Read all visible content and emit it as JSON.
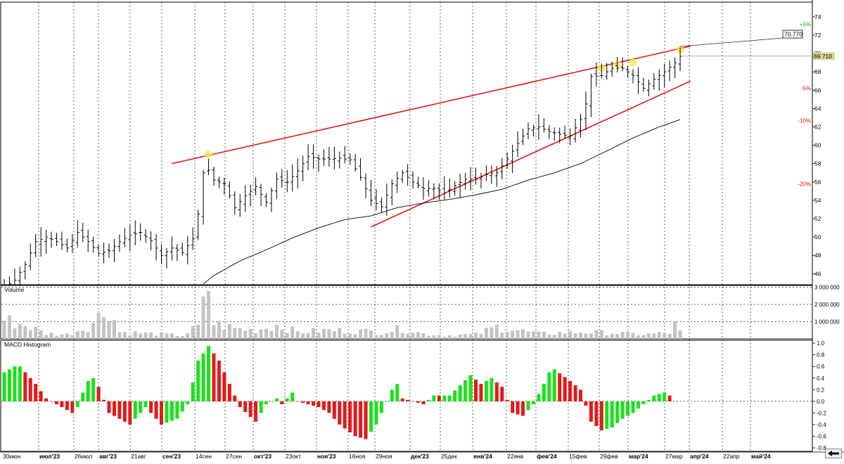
{
  "chart_data": {
    "type": "ohlc",
    "x_labels": [
      {
        "text": "30июн",
        "bold": false,
        "grid": false
      },
      {
        "text": "июл'23",
        "bold": true,
        "grid": true
      },
      {
        "text": "26июл",
        "bold": false,
        "grid": true
      },
      {
        "text": "авг'23",
        "bold": true,
        "grid": true
      },
      {
        "text": "21авг",
        "bold": false,
        "grid": true
      },
      {
        "text": "сен'23",
        "bold": true,
        "grid": true
      },
      {
        "text": "14сен",
        "bold": false,
        "grid": true
      },
      {
        "text": "27сен",
        "bold": false,
        "grid": true
      },
      {
        "text": "окт'23",
        "bold": true,
        "grid": true
      },
      {
        "text": "23окт",
        "bold": false,
        "grid": true
      },
      {
        "text": "ноя'23",
        "bold": true,
        "grid": true
      },
      {
        "text": "16ноя",
        "bold": false,
        "grid": true
      },
      {
        "text": "29ноя",
        "bold": false,
        "grid": true
      },
      {
        "text": "дек'23",
        "bold": true,
        "grid": true
      },
      {
        "text": "25дек",
        "bold": false,
        "grid": true
      },
      {
        "text": "янв'24",
        "bold": true,
        "grid": true
      },
      {
        "text": "22янв",
        "bold": false,
        "grid": true
      },
      {
        "text": "фев'24",
        "bold": true,
        "grid": true
      },
      {
        "text": "15фев",
        "bold": false,
        "grid": true
      },
      {
        "text": "29фев",
        "bold": false,
        "grid": true
      },
      {
        "text": "мар'24",
        "bold": true,
        "grid": true
      },
      {
        "text": "27мар",
        "bold": false,
        "grid": true
      },
      {
        "text": "апр'24",
        "bold": true,
        "grid": true
      },
      {
        "text": "22апр",
        "bold": false,
        "grid": true
      },
      {
        "text": "май'24",
        "bold": true,
        "grid": true
      }
    ],
    "price_panel": {
      "y_ticks": [
        46,
        48,
        50,
        52,
        54,
        56,
        58,
        60,
        62,
        64,
        66,
        68,
        70,
        72,
        74
      ],
      "ylim": [
        44.8,
        75.6
      ],
      "pct_labels": [
        {
          "text": "+5%",
          "value": 73.2,
          "color": "#2aa02a"
        },
        {
          "text": "-5%",
          "value": 66.2,
          "color": "#d01010"
        },
        {
          "text": "-10%",
          "value": 62.7,
          "color": "#d01010"
        },
        {
          "text": "-20%",
          "value": 55.8,
          "color": "#d01010"
        }
      ],
      "last_price": "69.710",
      "last_price_value": 69.71,
      "high_label": "70.770",
      "high_label_value": 70.77,
      "close_anchors": [
        [
          0,
          44.5
        ],
        [
          2,
          45.3
        ],
        [
          4,
          47.0
        ],
        [
          6,
          49.5
        ],
        [
          8,
          50.0
        ],
        [
          10,
          49.5
        ],
        [
          12,
          48.8
        ],
        [
          14,
          50.5
        ],
        [
          16,
          49.5
        ],
        [
          18,
          48.2
        ],
        [
          20,
          48.5
        ],
        [
          22,
          49.5
        ],
        [
          24,
          50.2
        ],
        [
          26,
          50.5
        ],
        [
          28,
          49.6
        ],
        [
          30,
          48.0
        ],
        [
          32,
          48.8
        ],
        [
          34,
          48.3
        ],
        [
          36,
          49.8
        ],
        [
          37,
          52.5
        ],
        [
          38,
          57.0
        ],
        [
          39,
          57.3
        ],
        [
          40,
          56.2
        ],
        [
          42,
          55.8
        ],
        [
          44,
          53.2
        ],
        [
          46,
          54.5
        ],
        [
          48,
          55.5
        ],
        [
          50,
          53.8
        ],
        [
          52,
          56.3
        ],
        [
          54,
          56.0
        ],
        [
          56,
          57.2
        ],
        [
          58,
          58.8
        ],
        [
          60,
          58.5
        ],
        [
          62,
          58.5
        ],
        [
          64,
          58.6
        ],
        [
          66,
          58.4
        ],
        [
          68,
          56.5
        ],
        [
          70,
          54.0
        ],
        [
          72,
          53.3
        ],
        [
          74,
          55.8
        ],
        [
          76,
          57.0
        ],
        [
          78,
          56.0
        ],
        [
          80,
          55.3
        ],
        [
          82,
          55.3
        ],
        [
          84,
          54.8
        ],
        [
          86,
          55.6
        ],
        [
          88,
          56.3
        ],
        [
          90,
          56.3
        ],
        [
          92,
          56.8
        ],
        [
          94,
          57.0
        ],
        [
          96,
          58.5
        ],
        [
          98,
          60.2
        ],
        [
          100,
          61.8
        ],
        [
          102,
          62.0
        ],
        [
          104,
          61.5
        ],
        [
          106,
          61.2
        ],
        [
          108,
          61.0
        ],
        [
          110,
          62.8
        ],
        [
          111,
          64.5
        ],
        [
          112,
          67.5
        ],
        [
          114,
          67.6
        ],
        [
          116,
          68.4
        ],
        [
          118,
          68.4
        ],
        [
          120,
          67.6
        ],
        [
          122,
          66.2
        ],
        [
          124,
          67.2
        ],
        [
          126,
          68.0
        ],
        [
          128,
          69.0
        ],
        [
          129,
          69.7
        ]
      ],
      "ma_anchors": [
        [
          38,
          44.9
        ],
        [
          40,
          45.8
        ],
        [
          45,
          47.4
        ],
        [
          50,
          48.6
        ],
        [
          55,
          49.9
        ],
        [
          60,
          51.0
        ],
        [
          65,
          51.9
        ],
        [
          70,
          52.3
        ],
        [
          75,
          53.2
        ],
        [
          80,
          53.7
        ],
        [
          85,
          54.1
        ],
        [
          90,
          54.6
        ],
        [
          95,
          55.2
        ],
        [
          100,
          56.2
        ],
        [
          105,
          57.0
        ],
        [
          110,
          58.0
        ],
        [
          114,
          59.1
        ],
        [
          120,
          60.8
        ],
        [
          125,
          62.0
        ],
        [
          129,
          62.8
        ]
      ],
      "trendlines": [
        {
          "from": [
            32,
            58.0
          ],
          "to": [
            131,
            70.8
          ],
          "color": "#e31a1a"
        },
        {
          "from": [
            70,
            51.1
          ],
          "to": [
            131,
            67.0
          ],
          "color": "#e31a1a"
        }
      ],
      "highlight_points": [
        [
          39,
          59.0
        ],
        [
          114,
          68.4
        ],
        [
          117,
          68.8
        ],
        [
          120,
          69.0
        ],
        [
          129,
          70.4
        ]
      ]
    },
    "volume_panel": {
      "title": "Volume",
      "y_ticks": [
        {
          "label": "3 000 000",
          "value": 3000000
        },
        {
          "label": "2 000 000",
          "value": 2000000
        },
        {
          "label": "1 000 000",
          "value": 1000000
        }
      ],
      "ylim": [
        0,
        3100000
      ],
      "volume_anchors": [
        [
          0,
          1100000
        ],
        [
          4,
          800000
        ],
        [
          8,
          300000
        ],
        [
          12,
          250000
        ],
        [
          16,
          700000
        ],
        [
          19,
          1500000
        ],
        [
          20,
          1800000
        ],
        [
          22,
          400000
        ],
        [
          28,
          300000
        ],
        [
          34,
          200000
        ],
        [
          37,
          700000
        ],
        [
          39,
          3000000
        ],
        [
          40,
          900000
        ],
        [
          44,
          600000
        ],
        [
          48,
          500000
        ],
        [
          52,
          800000
        ],
        [
          56,
          400000
        ],
        [
          62,
          500000
        ],
        [
          68,
          450000
        ],
        [
          72,
          400000
        ],
        [
          76,
          600000
        ],
        [
          80,
          300000
        ],
        [
          84,
          200000
        ],
        [
          90,
          250000
        ],
        [
          94,
          700000
        ],
        [
          98,
          500000
        ],
        [
          102,
          300000
        ],
        [
          110,
          400000
        ],
        [
          116,
          350000
        ],
        [
          122,
          250000
        ],
        [
          127,
          350000
        ],
        [
          128,
          800000
        ],
        [
          129,
          400000
        ]
      ]
    },
    "macd_panel": {
      "title": "MACD Histogram",
      "y_ticks": [
        1.0,
        0.8,
        0.6,
        0.4,
        0.2,
        0.0,
        -0.2,
        -0.4,
        -0.6,
        -0.8
      ],
      "ylim": [
        -0.86,
        1.05
      ],
      "macd_anchors": [
        [
          0,
          0.5
        ],
        [
          2,
          0.6
        ],
        [
          3,
          0.6
        ],
        [
          6,
          0.3
        ],
        [
          8,
          0.05
        ],
        [
          10,
          -0.05
        ],
        [
          12,
          -0.15
        ],
        [
          13,
          -0.2
        ],
        [
          14,
          -0.1
        ],
        [
          15,
          0.15
        ],
        [
          16,
          0.35
        ],
        [
          17,
          0.4
        ],
        [
          18,
          0.25
        ],
        [
          20,
          -0.2
        ],
        [
          24,
          -0.4
        ],
        [
          27,
          -0.1
        ],
        [
          30,
          -0.4
        ],
        [
          33,
          -0.3
        ],
        [
          35,
          -0.05
        ],
        [
          37,
          0.7
        ],
        [
          39,
          0.95
        ],
        [
          41,
          0.7
        ],
        [
          43,
          0.3
        ],
        [
          45,
          -0.1
        ],
        [
          48,
          -0.35
        ],
        [
          50,
          -0.05
        ],
        [
          52,
          0.05
        ],
        [
          53,
          -0.05
        ],
        [
          55,
          0.15
        ],
        [
          56,
          0.0
        ],
        [
          58,
          -0.05
        ],
        [
          60,
          -0.1
        ],
        [
          62,
          -0.2
        ],
        [
          64,
          -0.4
        ],
        [
          67,
          -0.6
        ],
        [
          69,
          -0.65
        ],
        [
          71,
          -0.4
        ],
        [
          73,
          0.0
        ],
        [
          74,
          0.2
        ],
        [
          75,
          0.3
        ],
        [
          76,
          0.05
        ],
        [
          80,
          -0.05
        ],
        [
          82,
          0.1
        ],
        [
          85,
          0.1
        ],
        [
          89,
          0.45
        ],
        [
          91,
          0.3
        ],
        [
          93,
          0.4
        ],
        [
          95,
          0.25
        ],
        [
          97,
          -0.2
        ],
        [
          99,
          -0.25
        ],
        [
          101,
          -0.05
        ],
        [
          103,
          0.3
        ],
        [
          104,
          0.5
        ],
        [
          105,
          0.55
        ],
        [
          108,
          0.35
        ],
        [
          110,
          0.2
        ],
        [
          112,
          -0.35
        ],
        [
          114,
          -0.5
        ],
        [
          116,
          -0.45
        ],
        [
          118,
          -0.3
        ],
        [
          120,
          -0.2
        ],
        [
          122,
          -0.05
        ],
        [
          124,
          0.1
        ],
        [
          126,
          0.15
        ],
        [
          127,
          0.1
        ]
      ]
    },
    "colors": {
      "bars": "#000000",
      "ma": "#000000",
      "trend": "#e31a1a",
      "highlight": "#f5e84a",
      "volume": "#c3c3c3",
      "macd_up": "#19e319",
      "macd_down": "#e31a1a",
      "grid": "#000000",
      "last_price_bg": "#dcd79a"
    }
  },
  "ui": {
    "nav_icon": "arrow-left-icon"
  }
}
